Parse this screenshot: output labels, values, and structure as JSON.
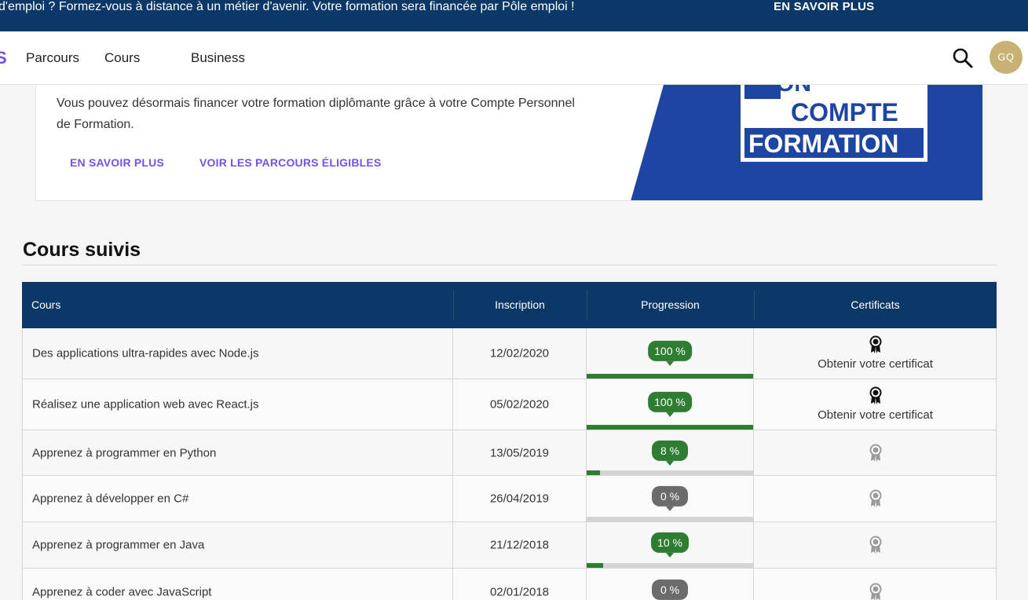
{
  "banner": {
    "message": "d'emploi ? Formez-vous à distance à un métier d'avenir. Votre formation sera financée par Pôle emploi !",
    "cta": "EN SAVOIR PLUS"
  },
  "nav": {
    "logo_fragment": "S",
    "links": [
      "Parcours",
      "Cours",
      "Business"
    ],
    "avatar_initials": "GQ"
  },
  "cpf": {
    "text": "Vous pouvez désormais financer votre formation diplômante grâce à votre Compte Personnel de Formation.",
    "link_more": "EN SAVOIR PLUS",
    "link_eligible": "VOIR LES PARCOURS ÉLIGIBLES",
    "logo_line1": "MON",
    "logo_line2": "COMPTE",
    "logo_line3": "FORMATION"
  },
  "section": {
    "title": "Cours suivis"
  },
  "table": {
    "headers": {
      "course": "Cours",
      "inscription": "Inscription",
      "progress": "Progression",
      "certificates": "Certificats"
    },
    "rows": [
      {
        "title": "Des applications ultra-rapides avec Node.js",
        "date": "12/02/2020",
        "progress_label": "100 %",
        "progress": 100,
        "certified": true,
        "cert_text": "Obtenir votre certificat"
      },
      {
        "title": "Réalisez une application web avec React.js",
        "date": "05/02/2020",
        "progress_label": "100 %",
        "progress": 100,
        "certified": true,
        "cert_text": "Obtenir votre certificat"
      },
      {
        "title": "Apprenez à programmer en Python",
        "date": "13/05/2019",
        "progress_label": "8 %",
        "progress": 8,
        "certified": false,
        "cert_text": ""
      },
      {
        "title": "Apprenez à développer en C#",
        "date": "26/04/2019",
        "progress_label": "0 %",
        "progress": 0,
        "certified": false,
        "cert_text": ""
      },
      {
        "title": "Apprenez à programmer en Java",
        "date": "21/12/2018",
        "progress_label": "10 %",
        "progress": 10,
        "certified": false,
        "cert_text": ""
      },
      {
        "title": "Apprenez à coder avec JavaScript",
        "date": "02/01/2018",
        "progress_label": "0 %",
        "progress": 0,
        "certified": false,
        "cert_text": ""
      }
    ]
  },
  "colors": {
    "brand_navy": "#0c3868",
    "accent_purple": "#7451eb",
    "progress_green": "#2e7d32",
    "progress_grey": "#6b6b6b",
    "cpf_blue": "#1d45a2"
  },
  "icons": {
    "search": "search-icon",
    "certificate": "award-ribbon-icon"
  }
}
